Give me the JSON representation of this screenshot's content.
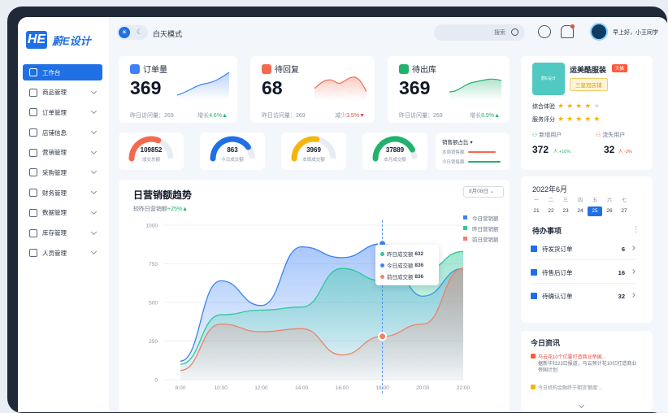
{
  "app": {
    "logo_mark": "HE",
    "logo_text": "蔚E设计"
  },
  "sidebar": {
    "items": [
      {
        "label": "工作台",
        "icon": "dashboard-icon",
        "active": true
      },
      {
        "label": "商品管理",
        "icon": "box-icon"
      },
      {
        "label": "订单管理",
        "icon": "order-icon"
      },
      {
        "label": "店铺信息",
        "icon": "store-icon"
      },
      {
        "label": "营销管理",
        "icon": "marketing-icon"
      },
      {
        "label": "采购管理",
        "icon": "cart-icon"
      },
      {
        "label": "财务管理",
        "icon": "finance-icon"
      },
      {
        "label": "数据管理",
        "icon": "data-icon"
      },
      {
        "label": "库存管理",
        "icon": "inventory-icon"
      },
      {
        "label": "人员管理",
        "icon": "user-icon"
      }
    ]
  },
  "topbar": {
    "mode_label": "白天模式",
    "search_placeholder": "搜索",
    "greeting": "早上好，小王同学"
  },
  "stats": [
    {
      "title": "订单量",
      "value": "369",
      "foot": "昨日访问量：269",
      "trend_label": "增长",
      "trend_value": "4.6%",
      "dir": "up",
      "color": "#3b82f6"
    },
    {
      "title": "待回复",
      "value": "68",
      "foot": "昨日访问量：269",
      "trend_label": "减少",
      "trend_value": "3.5%",
      "dir": "down",
      "color": "#f26b4f"
    },
    {
      "title": "待出库",
      "value": "369",
      "foot": "昨日访问量：269",
      "trend_label": "增长",
      "trend_value": "8.9%",
      "dir": "up",
      "color": "#23b26d"
    }
  ],
  "gauges": [
    {
      "value": "109852",
      "label": "成交总额",
      "color": "#f26b4f",
      "ratio": 0.62
    },
    {
      "value": "863",
      "label": "今日成交额",
      "color": "#1f6fe5",
      "ratio": 0.8
    },
    {
      "value": "3969",
      "label": "本周成交额",
      "color": "#f5b50a",
      "ratio": 0.55
    },
    {
      "value": "37889",
      "label": "本月成交额",
      "color": "#23b26d",
      "ratio": 0.85
    }
  ],
  "sales_ratio": {
    "title": "销售额占比",
    "rows": [
      {
        "label": "本周销售额",
        "color": "#f26b4f"
      },
      {
        "label": "今日销售额",
        "color": "#23b26d"
      }
    ]
  },
  "main_chart": {
    "title": "日营销额趋势",
    "subtitle": "较昨日营销额",
    "subtitle_change": "+25%",
    "date_select": "8月08日"
  },
  "chart_data": {
    "type": "area",
    "title": "日营销额趋势",
    "x": [
      "8:00",
      "10:00",
      "12:00",
      "14:00",
      "16:00",
      "18:00",
      "20:00",
      "22:00"
    ],
    "ylim": [
      0,
      1000
    ],
    "yticks": [
      0,
      250,
      500,
      750,
      1000
    ],
    "series": [
      {
        "name": "今日营销额",
        "color": "#3b82f6",
        "values": [
          120,
          640,
          480,
          860,
          790,
          880,
          540,
          720
        ]
      },
      {
        "name": "昨日营销额",
        "color": "#2fc79a",
        "values": [
          100,
          420,
          450,
          470,
          720,
          640,
          700,
          830
        ]
      },
      {
        "name": "前日营销额",
        "color": "#f0826b",
        "values": [
          60,
          360,
          310,
          330,
          160,
          280,
          360,
          720
        ]
      }
    ],
    "tooltip": [
      {
        "label": "昨日成交额",
        "value": "632",
        "color": "#2fc79a"
      },
      {
        "label": "今日成交额",
        "value": "836",
        "color": "#3b82f6"
      },
      {
        "label": "前日成交额",
        "value": "836",
        "color": "#f0826b"
      }
    ]
  },
  "shop": {
    "logo_text": "蔚E设计",
    "name": "运美酷服装",
    "tag": "天猫",
    "badge": "三皇冠店铺",
    "ratings": [
      {
        "label": "综合体验",
        "stars": 4
      },
      {
        "label": "服务评分",
        "stars": 5
      }
    ],
    "new_users_label": "新增用户",
    "new_users_value": "372",
    "new_users_change": "人 +10%",
    "lost_users_label": "流失用户",
    "lost_users_value": "32",
    "lost_users_change": "人 -3%"
  },
  "calendar": {
    "title": "2022年6月",
    "weekdays": [
      "一",
      "二",
      "三",
      "四",
      "五",
      "六",
      "七"
    ],
    "days": [
      "21",
      "22",
      "23",
      "24",
      "25",
      "26",
      "27"
    ],
    "today": "25"
  },
  "todo": {
    "title": "待办事项",
    "more": "⋮",
    "items": [
      {
        "label": "待发货订单",
        "count": "6"
      },
      {
        "label": "待售后订单",
        "count": "16"
      },
      {
        "label": "待确认订单",
        "count": "32"
      }
    ]
  },
  "news": {
    "title": "今日资讯",
    "items": [
      {
        "headline": "马云花10个亿要打造商业帝国...",
        "summary": "据新华社23日报道，马云预计花10亿打造商业帝国计划"
      },
      {
        "headline": "今日机构金融终于期货'额度'..."
      }
    ]
  }
}
